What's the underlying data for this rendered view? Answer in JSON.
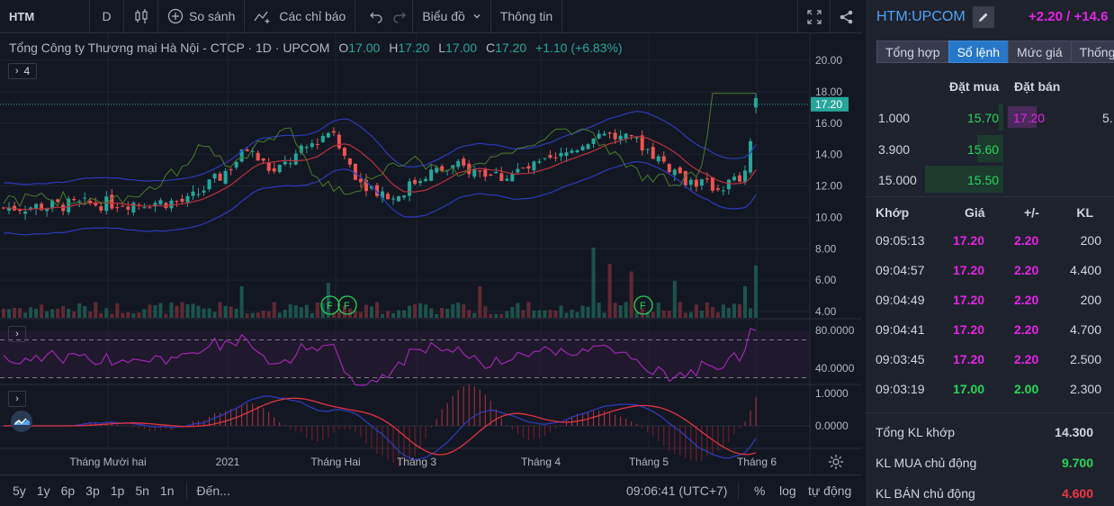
{
  "toolbar": {
    "symbol": "HTM",
    "resolution": "D",
    "compare_label": "So sánh",
    "indicators_label": "Các chỉ báo",
    "chart_mode_label": "Biểu đồ",
    "info_label": "Thông tin"
  },
  "legend": {
    "title": "Tổng Công ty Thương mại Hà Nội - CTCP · 1D · UPCOM",
    "o_key": "O",
    "o_val": "17.00",
    "h_key": "H",
    "h_val": "17.20",
    "l_key": "L",
    "l_val": "17.00",
    "c_key": "C",
    "c_val": "17.20",
    "change": "+1.10 (+6.83%)",
    "collapse_count": "4"
  },
  "price_axis": {
    "labels": [
      "20.00",
      "18.00",
      "16.00",
      "14.00",
      "12.00",
      "10.00",
      "8.00",
      "6.00",
      "4.00"
    ],
    "current_price": "17.20"
  },
  "osc_axis": {
    "labels": [
      "80.0000",
      "40.0000"
    ]
  },
  "macd_axis": {
    "labels": [
      "1.0000",
      "0.0000"
    ]
  },
  "time_axis": {
    "labels": [
      "Tháng Mười hai",
      "2021",
      "Tháng Hai",
      "Tháng 3",
      "Tháng 4",
      "Tháng 5",
      "Tháng 6"
    ]
  },
  "events": [
    "F",
    "F",
    "F"
  ],
  "bottom": {
    "ranges": [
      "5y",
      "1y",
      "6p",
      "3p",
      "1p",
      "5n",
      "1n"
    ],
    "goto": "Đến...",
    "time": "09:06:41 (UTC+7)",
    "pct": "%",
    "log": "log",
    "auto": "tự động"
  },
  "side": {
    "symbol": "HTM:UPCOM",
    "change": "+2.20 / +14.6",
    "tabs": [
      "Tổng hợp",
      "Sổ lệnh",
      "Mức giá",
      "Thống"
    ],
    "orderbook": {
      "bid_header": "Đặt mua",
      "ask_header": "Đặt bán",
      "rows": [
        {
          "vol": "1.000",
          "bid": "15.70",
          "ask": "17.20",
          "askvol": "5."
        },
        {
          "vol": "3.900",
          "bid": "15.60"
        },
        {
          "vol": "15.000",
          "bid": "15.50"
        }
      ]
    },
    "trades": {
      "headers": [
        "Khớp",
        "Giá",
        "+/-",
        "KL"
      ],
      "rows": [
        {
          "time": "09:05:13",
          "price": "17.20",
          "chg": "2.20",
          "vol": "200"
        },
        {
          "time": "09:04:57",
          "price": "17.20",
          "chg": "2.20",
          "vol": "4.400"
        },
        {
          "time": "09:04:49",
          "price": "17.20",
          "chg": "2.20",
          "vol": "200"
        },
        {
          "time": "09:04:41",
          "price": "17.20",
          "chg": "2.20",
          "vol": "4.700"
        },
        {
          "time": "09:03:45",
          "price": "17.20",
          "chg": "2.20",
          "vol": "2.500"
        },
        {
          "time": "09:03:19",
          "price": "17.00",
          "chg": "2.00",
          "vol": "2.300"
        }
      ]
    },
    "summary": {
      "total_label": "Tổng KL khớp",
      "total_val": "14.300",
      "buy_label": "KL MUA chủ động",
      "buy_val": "9.700",
      "sell_label": "KL BÁN chủ động",
      "sell_val": "4.600"
    }
  },
  "colors": {
    "up": "#26a69a",
    "down": "#ef5350",
    "magenta": "#e424e4",
    "green": "#26d65a",
    "accent": "#2677c8"
  },
  "icons": [
    "candles-icon",
    "plus-circle-icon",
    "indicators-icon",
    "undo-icon",
    "redo-icon",
    "chevron-down-icon",
    "fullscreen-icon",
    "share-icon",
    "pencil-icon",
    "gear-icon",
    "logo-icon"
  ]
}
